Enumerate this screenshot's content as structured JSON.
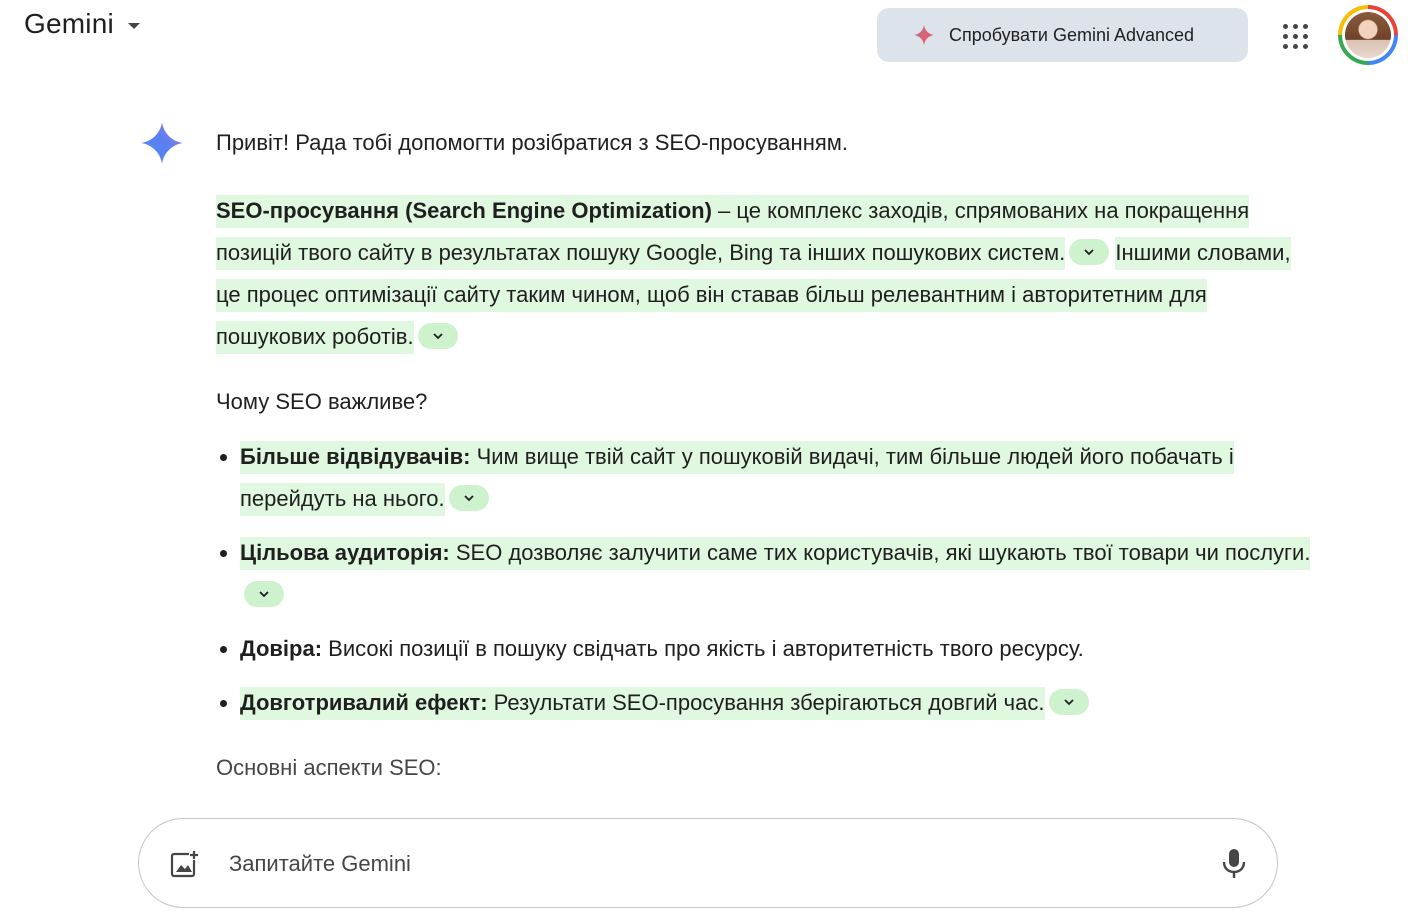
{
  "header": {
    "brand": "Gemini",
    "advanced_label": "Спробувати Gemini Advanced"
  },
  "icons": {
    "brand_dropdown": "caret-down-icon",
    "advanced_spark": "sparkle-icon",
    "apps": "apps-grid-icon",
    "avatar": "user-avatar",
    "response_logo": "gemini-sparkle-icon",
    "chevron": "chevron-down-icon",
    "image_upload": "add-image-icon",
    "mic": "microphone-icon"
  },
  "colors": {
    "highlight": "#e0f8e0",
    "chip": "#cdf2cd",
    "advanced_bg": "#dde3ea"
  },
  "response": {
    "intro": "Привіт! Рада тобі допомогти розібратися з SEO-просуванням.",
    "def_bold": "SEO-просування (Search Engine Optimization)",
    "def_rest": " – це комплекс заходів, спрямованих на покращення позицій твого сайту в результатах пошуку Google, Bing та інших пошукових систем.",
    "def_2": "Іншими словами, це процес оптимізації сайту таким чином, щоб він ставав більш релевантним і авторитетним для пошукових роботів.",
    "why_heading": "Чому SEO важливе?",
    "bullets": [
      {
        "bold": "Більше відвідувачів:",
        "text": " Чим вище твій сайт у пошуковій видачі, тим більше людей його побачать і перейдуть на нього.",
        "highlight": true
      },
      {
        "bold": "Цільова аудиторія:",
        "text": " SEO дозволяє залучити саме тих користувачів, які шукають твої товари чи послуги.",
        "highlight": true
      },
      {
        "bold": "Довіра:",
        "text": " Високі позиції в пошуку свідчать про якість і авторитетність твого ресурсу.",
        "highlight": false
      },
      {
        "bold": "Довготривалий ефект:",
        "text": " Результати SEO-просування зберігаються довгий час.",
        "highlight": true
      }
    ],
    "aspects_heading": "Основні аспекти SEO:"
  },
  "input": {
    "placeholder": "Запитайте Gemini"
  }
}
